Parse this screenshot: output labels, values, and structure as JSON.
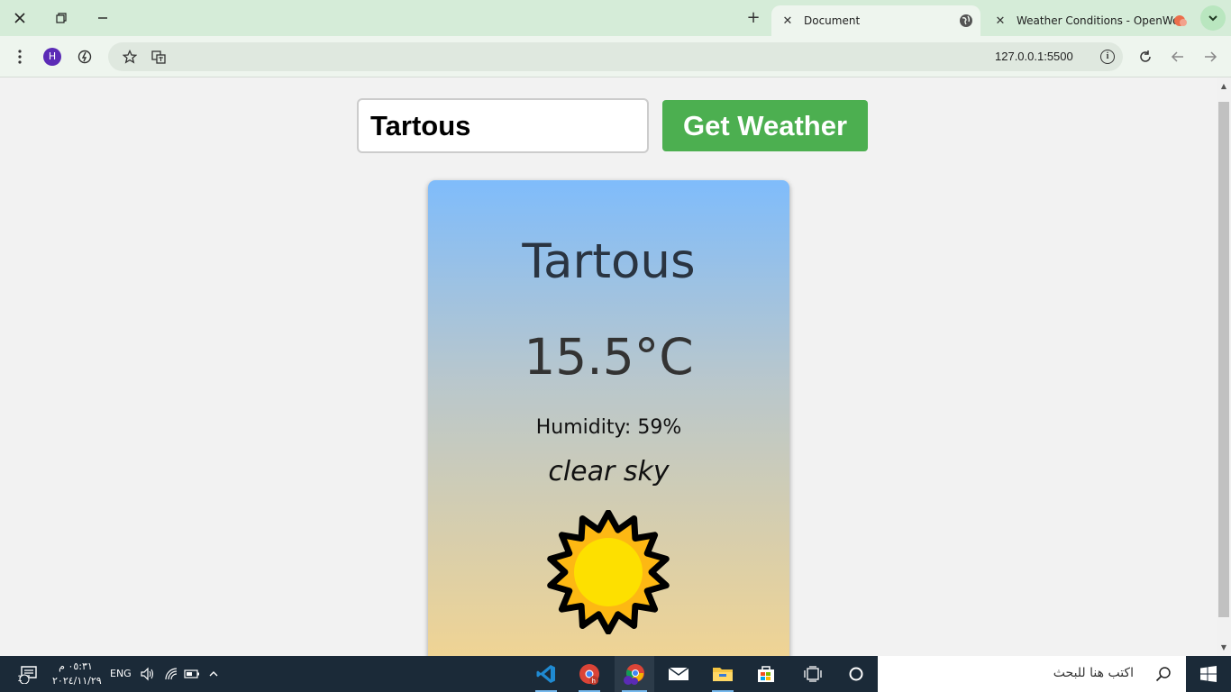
{
  "browser": {
    "tabs": [
      {
        "title": "Document",
        "active": true
      },
      {
        "title": "Weather Conditions - OpenWea",
        "active": false
      }
    ],
    "url": "127.0.0.1:5500",
    "profile_initial": "H"
  },
  "app": {
    "city_input_value": "Tartous",
    "get_weather_label": "Get Weather",
    "card": {
      "city": "Tartous",
      "temperature": "15.5°C",
      "humidity": "Humidity: 59%",
      "description": "clear sky",
      "icon": "sun-icon"
    }
  },
  "taskbar": {
    "search_placeholder": "اكتب هنا للبحث",
    "language": "ENG",
    "time": "٠٥:٣١ م",
    "date": "٢٠٢٤/١١/٢٩",
    "notification_count": "1"
  },
  "colors": {
    "button_green": "#4caf50",
    "card_gradient_top": "#7fbcfb",
    "card_gradient_bottom": "#f5d58e",
    "tabbar_green": "#d5ecd8"
  }
}
